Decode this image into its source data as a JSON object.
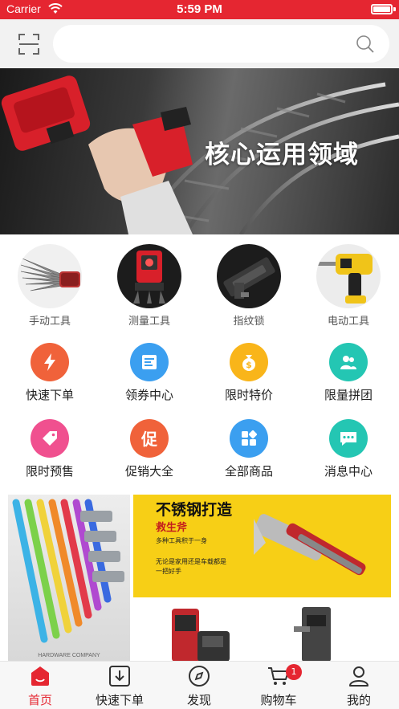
{
  "status_bar": {
    "carrier": "Carrier",
    "time": "5:59 PM"
  },
  "search": {
    "placeholder": ""
  },
  "banner": {
    "text": "核心运用领域"
  },
  "categories": [
    {
      "label": "手动工具"
    },
    {
      "label": "测量工具"
    },
    {
      "label": "指纹锁"
    },
    {
      "label": "电动工具"
    }
  ],
  "functions": [
    {
      "label": "快速下单",
      "color": "#f0623a",
      "icon": "lightning-icon"
    },
    {
      "label": "领券中心",
      "color": "#3b9ff0",
      "icon": "coupon-icon"
    },
    {
      "label": "限时特价",
      "color": "#f9b51a",
      "icon": "money-bag-icon"
    },
    {
      "label": "限量拼团",
      "color": "#24c6b3",
      "icon": "group-icon"
    },
    {
      "label": "限时预售",
      "color": "#f0508f",
      "icon": "tag-icon"
    },
    {
      "label": "促销大全",
      "color": "#f0623a",
      "icon": "promo-icon"
    },
    {
      "label": "全部商品",
      "color": "#3b9ff0",
      "icon": "grid-icon"
    },
    {
      "label": "消息中心",
      "color": "#24c6b3",
      "icon": "message-icon"
    }
  ],
  "promo": {
    "left_caption": "HARDWARE COMPANY",
    "right_title": "不锈钢打造",
    "right_subtitle": "救生斧",
    "right_line1": "多种工具积于一身",
    "right_line2": "无论是家用还是车载都是一把好手"
  },
  "tabs": [
    {
      "label": "首页",
      "icon": "home-icon",
      "active": true
    },
    {
      "label": "快速下单",
      "icon": "download-icon",
      "active": false
    },
    {
      "label": "发现",
      "icon": "compass-icon",
      "active": false
    },
    {
      "label": "购物车",
      "icon": "cart-icon",
      "active": false,
      "badge": "1"
    },
    {
      "label": "我的",
      "icon": "user-icon",
      "active": false
    }
  ],
  "colors": {
    "brand": "#e52631",
    "topbar": "#f2f2f2"
  }
}
